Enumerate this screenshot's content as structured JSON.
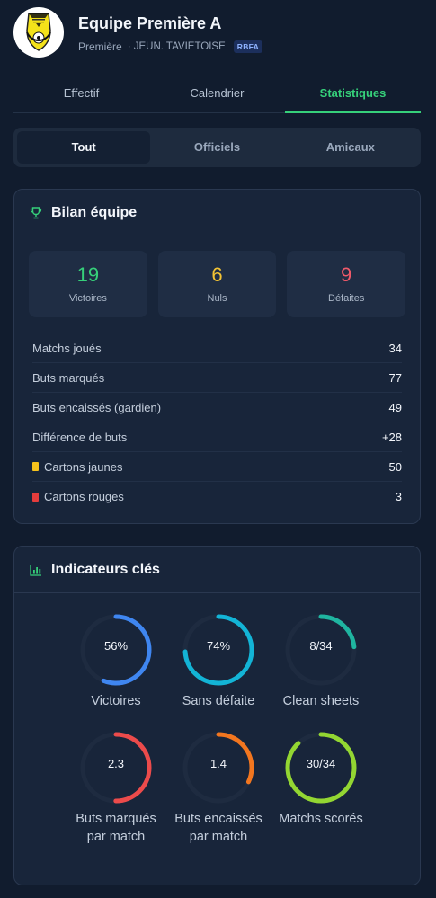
{
  "header": {
    "team_name": "Equipe Première A",
    "level": "Première",
    "club": "· JEUN. TAVIETOISE",
    "badge": "RBFA"
  },
  "tabs": [
    {
      "label": "Effectif",
      "active": false
    },
    {
      "label": "Calendrier",
      "active": false
    },
    {
      "label": "Statistiques",
      "active": true
    }
  ],
  "filter": [
    {
      "label": "Tout",
      "active": true
    },
    {
      "label": "Officiels",
      "active": false
    },
    {
      "label": "Amicaux",
      "active": false
    }
  ],
  "bilan": {
    "title": "Bilan équipe",
    "boxes": [
      {
        "value": "19",
        "label": "Victoires",
        "color": "#36d07a"
      },
      {
        "value": "6",
        "label": "Nuls",
        "color": "#f3c334"
      },
      {
        "value": "9",
        "label": "Défaites",
        "color": "#ef5a6a"
      }
    ],
    "rows": [
      {
        "label": "Matchs joués",
        "value": "34"
      },
      {
        "label": "Buts marqués",
        "value": "77"
      },
      {
        "label": "Buts encaissés (gardien)",
        "value": "49"
      },
      {
        "label": "Différence de buts",
        "value": "+28"
      },
      {
        "label": "Cartons jaunes",
        "value": "50",
        "marker": "#f6c21c"
      },
      {
        "label": "Cartons rouges",
        "value": "3",
        "marker": "#e43c3c"
      }
    ]
  },
  "indicators": {
    "title": "Indicateurs clés",
    "gauges": [
      {
        "value": "56%",
        "label": "Victoires",
        "fraction": 0.56,
        "color": "#3f86f0"
      },
      {
        "value": "74%",
        "label": "Sans défaite",
        "fraction": 0.74,
        "color": "#13b4d6"
      },
      {
        "value": "8/34",
        "label": "Clean sheets",
        "fraction": 0.235,
        "color": "#1fb5a0"
      },
      {
        "value": "2.3",
        "label": "Buts marqués par match",
        "fraction": 0.5,
        "color": "#ec4b4b"
      },
      {
        "value": "1.4",
        "label": "Buts encaissés par match",
        "fraction": 0.32,
        "color": "#f2761f"
      },
      {
        "value": "30/34",
        "label": "Matchs scorés",
        "fraction": 0.88,
        "color": "#93d632"
      }
    ]
  },
  "colors": {
    "accent": "#36d07a",
    "background": "#111c2e",
    "card": "#18253a"
  }
}
